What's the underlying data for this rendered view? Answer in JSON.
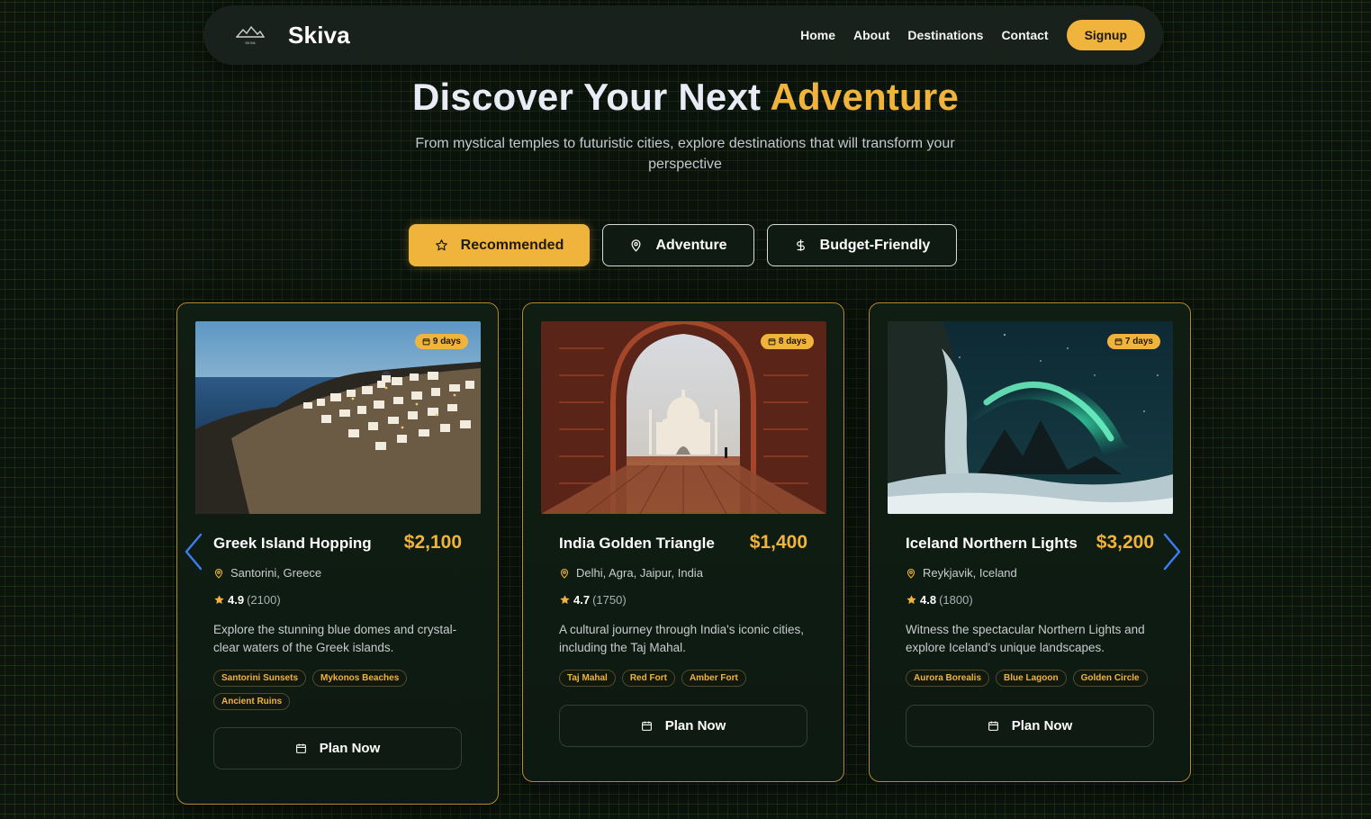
{
  "nav": {
    "brand": "Skiva",
    "logo_text": "SKIVA",
    "links": [
      "Home",
      "About",
      "Destinations",
      "Contact"
    ],
    "signup_label": "Signup"
  },
  "hero": {
    "title_main": "Discover Your Next",
    "title_accent": "Adventure",
    "subtitle": "From mystical temples to futuristic cities, explore destinations that will transform your perspective"
  },
  "filters": [
    {
      "label": "Recommended",
      "icon": "star-icon",
      "active": true
    },
    {
      "label": "Adventure",
      "icon": "map-pin-icon",
      "active": false
    },
    {
      "label": "Budget-Friendly",
      "icon": "dollar-icon",
      "active": false
    }
  ],
  "cards": [
    {
      "title": "Greek Island Hopping",
      "price": "$2,100",
      "days": "9 days",
      "location": "Santorini, Greece",
      "rating": "4.9",
      "reviews": "(2100)",
      "description": "Explore the stunning blue domes and crystal-clear waters of the Greek islands.",
      "tags": [
        "Santorini Sunsets",
        "Mykonos Beaches",
        "Ancient Ruins"
      ],
      "cta": "Plan Now"
    },
    {
      "title": "India Golden Triangle",
      "price": "$1,400",
      "days": "8 days",
      "location": "Delhi, Agra, Jaipur, India",
      "rating": "4.7",
      "reviews": "(1750)",
      "description": "A cultural journey through India's iconic cities, including the Taj Mahal.",
      "tags": [
        "Taj Mahal",
        "Red Fort",
        "Amber Fort"
      ],
      "cta": "Plan Now"
    },
    {
      "title": "Iceland Northern Lights",
      "price": "$3,200",
      "days": "7 days",
      "location": "Reykjavik, Iceland",
      "rating": "4.8",
      "reviews": "(1800)",
      "description": "Witness the spectacular Northern Lights and explore Iceland's unique landscapes.",
      "tags": [
        "Aurora Borealis",
        "Blue Lagoon",
        "Golden Circle"
      ],
      "cta": "Plan Now"
    }
  ],
  "colors": {
    "accent": "#f0b43c",
    "background": "#0c150d",
    "card_border": "#b48a32",
    "arrow": "#3d7bf0"
  }
}
